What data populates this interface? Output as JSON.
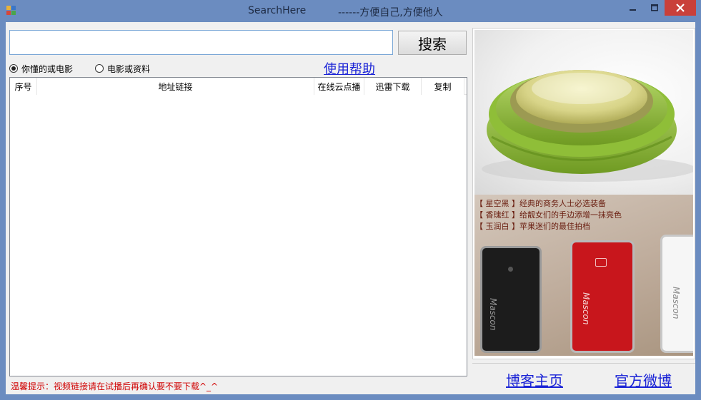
{
  "window": {
    "title": "SearchHere",
    "slogan": "------方便自己,方便他人"
  },
  "search": {
    "value": "",
    "placeholder": "",
    "button_label": "搜索"
  },
  "options": [
    {
      "label": "你懂的或电影",
      "checked": true
    },
    {
      "label": "电影或资料",
      "checked": false
    }
  ],
  "help_link": "使用帮助",
  "table": {
    "columns": [
      "序号",
      "地址链接",
      "在线云点播",
      "迅雷下载",
      "复制"
    ],
    "rows": []
  },
  "tip": "温馨提示：视频链接请在试播后再确认要不要下载^_^",
  "ad": {
    "captions": [
      "【 星空黑 】经典的商务人士必选装备",
      "【 香瑰红 】给靓女们的手边添增一抹亮色",
      "【 玉润白 】苹果迷们的最佳拍档"
    ],
    "brand": "Mascon"
  },
  "links": {
    "blog": "博客主页",
    "weibo": "官方微博"
  },
  "colors": {
    "titlebar": "#6b8cc0",
    "close_button": "#c9403a",
    "link": "#1a23d6",
    "tip": "#d00000"
  }
}
